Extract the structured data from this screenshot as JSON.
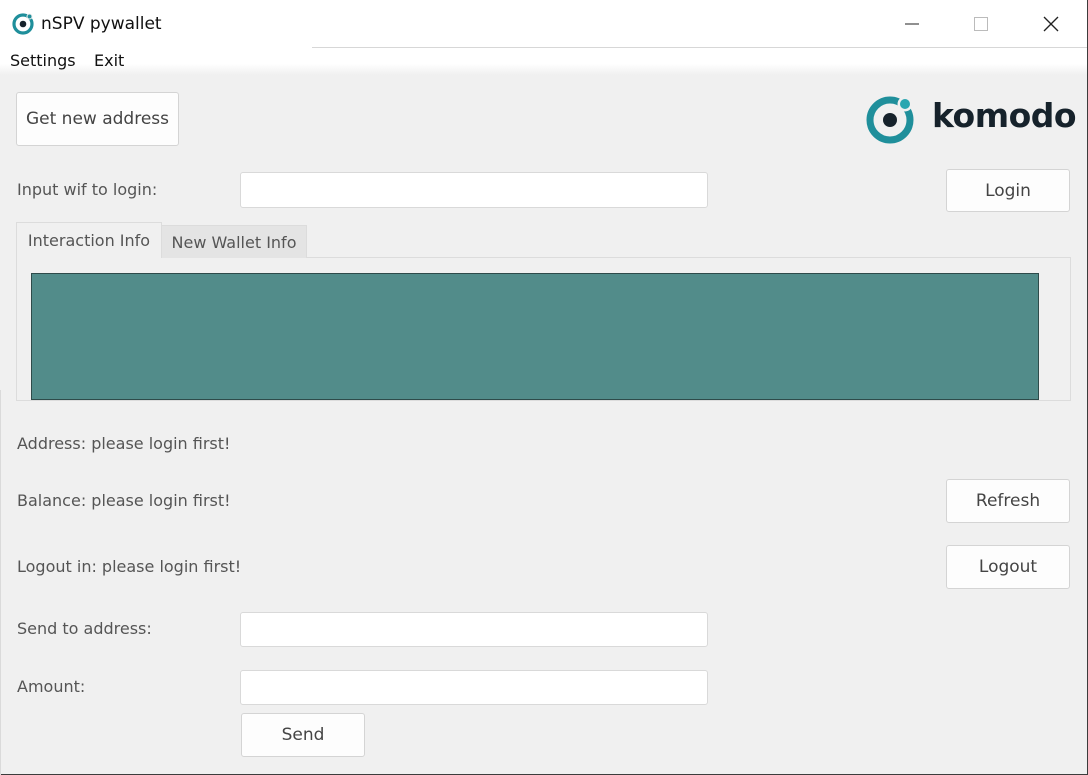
{
  "window": {
    "title": "nSPV pywallet",
    "controls": {
      "minimize_icon": "minimize-icon",
      "maximize_icon": "maximize-icon",
      "close_icon": "close-icon"
    }
  },
  "menu": {
    "items": [
      "Settings",
      "Exit"
    ]
  },
  "header": {
    "new_address_label": "Get new address",
    "logo_text": "komodo"
  },
  "login": {
    "label": "Input wif to login:",
    "value": "",
    "button": "Login"
  },
  "tabs": [
    {
      "label": "Interaction Info",
      "active": true
    },
    {
      "label": "New Wallet Info",
      "active": false
    }
  ],
  "info_area": {
    "color": "#528c8a",
    "content": ""
  },
  "status": {
    "address": "Address: please login first!",
    "balance": "Balance: please login first!",
    "logout": "Logout in: please login first!"
  },
  "actions": {
    "refresh": "Refresh",
    "logout": "Logout"
  },
  "send": {
    "to_label": "Send to address:",
    "to_value": "",
    "amount_label": "Amount:",
    "amount_value": "",
    "button": "Send"
  },
  "colors": {
    "logo_teal": "#1f8f9b",
    "logo_dark": "#16222b",
    "info_bg": "#528c8a"
  }
}
